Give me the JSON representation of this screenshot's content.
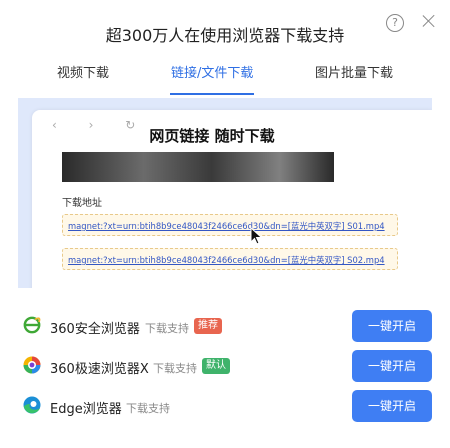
{
  "dialog": {
    "title": "超300万人在使用浏览器下载支持",
    "help_glyph": "?"
  },
  "tabs": [
    {
      "label": "视频下载"
    },
    {
      "label": "链接/文件下载",
      "active": true
    },
    {
      "label": "图片批量下载"
    }
  ],
  "preview": {
    "nav_glyphs": "‹ › ↻",
    "headline": "网页链接 随时下载",
    "address_label": "下载地址",
    "links": [
      "magnet:?xt=urn:btih8b9ce48043f2466ce6d30&dn=[蓝光中英双字] S01.mp4",
      "magnet:?xt=urn:btih8b9ce48043f2466ce6d30&dn=[蓝光中英双字] S02.mp4"
    ]
  },
  "browsers": [
    {
      "name": "360安全浏览器",
      "support": "下载支持",
      "badge": "推荐",
      "badge_color": "#e8654f",
      "button": "一键开启",
      "icon": "360-safe-browser-icon"
    },
    {
      "name": "360极速浏览器X",
      "support": "下载支持",
      "badge": "默认",
      "badge_color": "#3fb36b",
      "button": "一键开启",
      "icon": "360-speed-browser-icon"
    },
    {
      "name": "Edge浏览器",
      "support": "下载支持",
      "badge": "",
      "button": "一键开启",
      "icon": "edge-browser-icon"
    }
  ],
  "colors": {
    "accent": "#2f6fe4",
    "button": "#3f7ef3"
  }
}
